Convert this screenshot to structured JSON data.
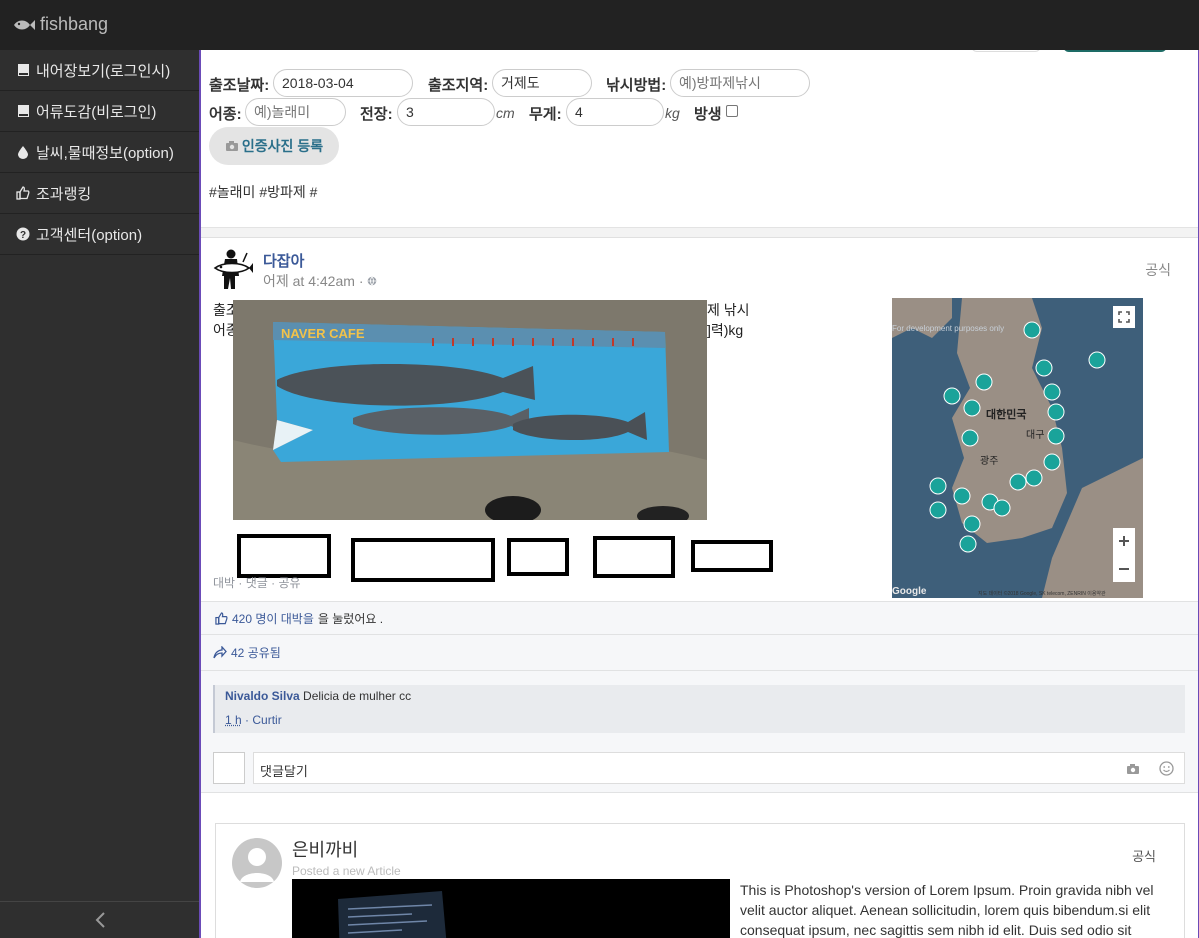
{
  "app": {
    "brand": "fishbang"
  },
  "sidebar": {
    "items": [
      {
        "label": "내어장보기(로그인시)"
      },
      {
        "label": "어류도감(비로그인)"
      },
      {
        "label": "날씨,물때정보(option)"
      },
      {
        "label": "조과랭킹"
      },
      {
        "label": "고객센터(option)"
      }
    ],
    "collapse": "‹"
  },
  "form": {
    "date_label": "출조날짜:",
    "date_value": "2018-03-04",
    "region_label": "출조지역:",
    "region_value": "거제도",
    "method_label": "낚시방법:",
    "method_placeholder": "예)방파제낚시",
    "species_label": "어종:",
    "species_placeholder": "예)놀래미",
    "length_label": "전장:",
    "length_value": "3",
    "length_unit": "cm",
    "weight_label": "무게:",
    "weight_value": "4",
    "weight_unit": "kg",
    "release_label": "방생",
    "photo_button": "인증사진 등록",
    "tags": "#놀래미 #방파제 #"
  },
  "post": {
    "author": "다잡아",
    "time": "어제 at 4:42am",
    "badge": "공식",
    "text_left_1": "출조",
    "text_left_2": "어종",
    "text_right_1": "제 낚시",
    "text_right_2": "]력)kg",
    "actions": "대박 · 댓글 · 공유",
    "likes": "420 명이 대박을",
    "likes_suffix": "을 눌렀어요 .",
    "shares": "42 공유됨",
    "image_caption": "NAVER CAFE",
    "map": {
      "label_korea": "대한민국",
      "label_daegu": "대구",
      "label_gwangju": "광주",
      "dev_text": "For development purposes only",
      "google": "Google",
      "copyright": "지도 데이터 ©2018 Google, SK telecom, ZENRIN  이용약관"
    }
  },
  "comment": {
    "author": "Nivaldo Silva",
    "text": "Delicia de mulher cc",
    "time": "1 h",
    "action": "· Curtir",
    "write_placeholder": "댓글달기"
  },
  "card2": {
    "author": "은비까비",
    "subtitle": "Posted a new Article",
    "badge": "공식",
    "body": "This is Photoshop's version of Lorem Ipsum. Proin gravida nibh vel velit auctor aliquet. Aenean sollicitudin, lorem quis bibendum.si elit consequat ipsum, nec sagittis sem nibh id elit. Duis sed odio sit amet"
  }
}
